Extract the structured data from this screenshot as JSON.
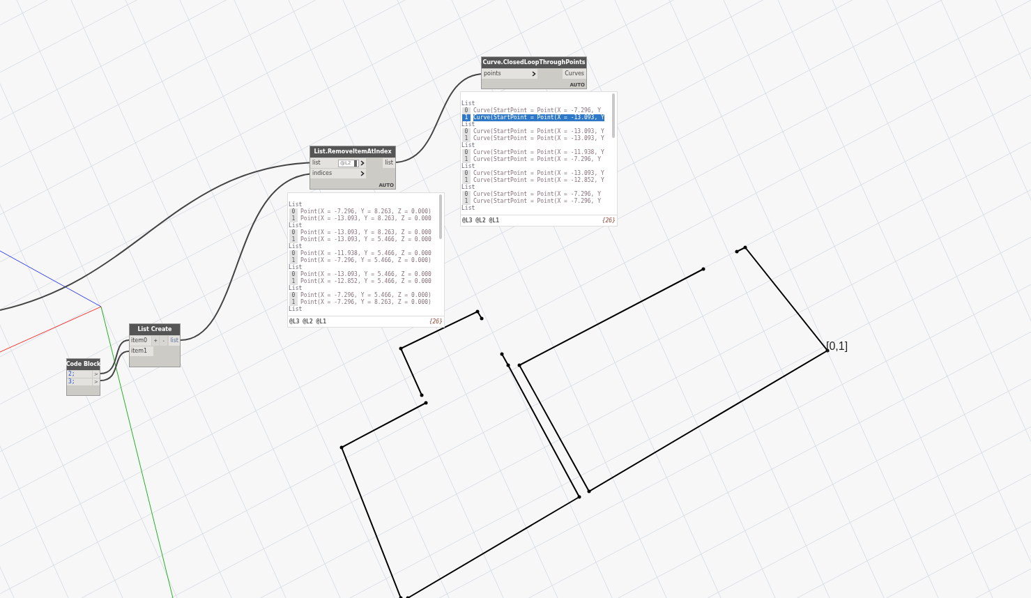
{
  "canvas": {
    "point_label": "[0,1]"
  },
  "nodes": [
    {
      "kind": "code_block",
      "title": "Code Block",
      "lines": [
        "2;",
        "3;"
      ],
      "outputs": [
        ">",
        ">"
      ]
    },
    {
      "kind": "list_create",
      "title": "List Create",
      "inputs": [
        {
          "label": "item0"
        },
        {
          "label": "item1"
        }
      ],
      "buttons": [
        "+",
        "-"
      ],
      "outputs": [
        "list"
      ]
    },
    {
      "kind": "function",
      "title": "List.RemoveItemAtIndex",
      "inputs": [
        {
          "label": "list",
          "level": "@L2"
        },
        {
          "label": "indices"
        }
      ],
      "outputs": [
        "list"
      ],
      "lacing": "AUTO",
      "preview": {
        "lines": [
          {
            "kind": "header",
            "text": "List",
            "selected": false
          },
          {
            "kind": "item",
            "index": "0",
            "text": "Point(X = -7.296, Y = 8.263, Z = 0.000)",
            "selected": false
          },
          {
            "kind": "item",
            "index": "1",
            "text": "Point(X = -13.093, Y = 8.263, Z = 0.000",
            "selected": false
          },
          {
            "kind": "header",
            "text": "List",
            "selected": false
          },
          {
            "kind": "item",
            "index": "0",
            "text": "Point(X = -13.093, Y = 8.263, Z = 0.000",
            "selected": false
          },
          {
            "kind": "item",
            "index": "1",
            "text": "Point(X = -13.093, Y = 5.466, Z = 0.000",
            "selected": false
          },
          {
            "kind": "header",
            "text": "List",
            "selected": false
          },
          {
            "kind": "item",
            "index": "0",
            "text": "Point(X = -11.938, Y = 5.466, Z = 0.000",
            "selected": false
          },
          {
            "kind": "item",
            "index": "1",
            "text": "Point(X = -7.296, Y = 5.466, Z = 0.000)",
            "selected": false
          },
          {
            "kind": "header",
            "text": "List",
            "selected": false
          },
          {
            "kind": "item",
            "index": "0",
            "text": "Point(X = -13.093, Y = 5.466, Z = 0.000",
            "selected": false
          },
          {
            "kind": "item",
            "index": "1",
            "text": "Point(X = -12.852, Y = 5.466, Z = 0.000",
            "selected": false
          },
          {
            "kind": "header",
            "text": "List",
            "selected": false
          },
          {
            "kind": "item",
            "index": "0",
            "text": "Point(X = -7.296, Y = 5.466, Z = 0.000)",
            "selected": false
          },
          {
            "kind": "item",
            "index": "1",
            "text": "Point(X = -7.296, Y = 8.263, Z = 0.000)",
            "selected": false
          },
          {
            "kind": "header",
            "text": "List",
            "selected": false
          }
        ],
        "levels": "@L3 @L2 @L1",
        "count": "{26}"
      }
    },
    {
      "kind": "function",
      "title": "Curve.ClosedLoopThroughPoints",
      "inputs": [
        {
          "label": "points"
        }
      ],
      "outputs": [
        "Curves"
      ],
      "lacing": "AUTO",
      "preview": {
        "lines": [
          {
            "kind": "header",
            "text": "List",
            "selected": false
          },
          {
            "kind": "item",
            "index": "0",
            "text": "Curve(StartPoint = Point(X = -7.296, Y",
            "selected": false
          },
          {
            "kind": "item",
            "index": "1",
            "text": "Curve(StartPoint = Point(X = -13.093, Y",
            "selected": true
          },
          {
            "kind": "header",
            "text": "List",
            "selected": false
          },
          {
            "kind": "item",
            "index": "0",
            "text": "Curve(StartPoint = Point(X = -13.093, Y",
            "selected": false
          },
          {
            "kind": "item",
            "index": "1",
            "text": "Curve(StartPoint = Point(X = -13.093, Y",
            "selected": false
          },
          {
            "kind": "header",
            "text": "List",
            "selected": false
          },
          {
            "kind": "item",
            "index": "0",
            "text": "Curve(StartPoint = Point(X = -11.938, Y",
            "selected": false
          },
          {
            "kind": "item",
            "index": "1",
            "text": "Curve(StartPoint = Point(X = -7.296, Y",
            "selected": false
          },
          {
            "kind": "header",
            "text": "List",
            "selected": false
          },
          {
            "kind": "item",
            "index": "0",
            "text": "Curve(StartPoint = Point(X = -13.093, Y",
            "selected": false
          },
          {
            "kind": "item",
            "index": "1",
            "text": "Curve(StartPoint = Point(X = -12.852, Y",
            "selected": false
          },
          {
            "kind": "header",
            "text": "List",
            "selected": false
          },
          {
            "kind": "item",
            "index": "0",
            "text": "Curve(StartPoint = Point(X = -7.296, Y",
            "selected": false
          },
          {
            "kind": "item",
            "index": "1",
            "text": "Curve(StartPoint = Point(X = -7.296, Y",
            "selected": false
          },
          {
            "kind": "header",
            "text": "List",
            "selected": false
          }
        ],
        "levels": "@L3 @L2 @L1",
        "count": "{26}"
      }
    }
  ]
}
